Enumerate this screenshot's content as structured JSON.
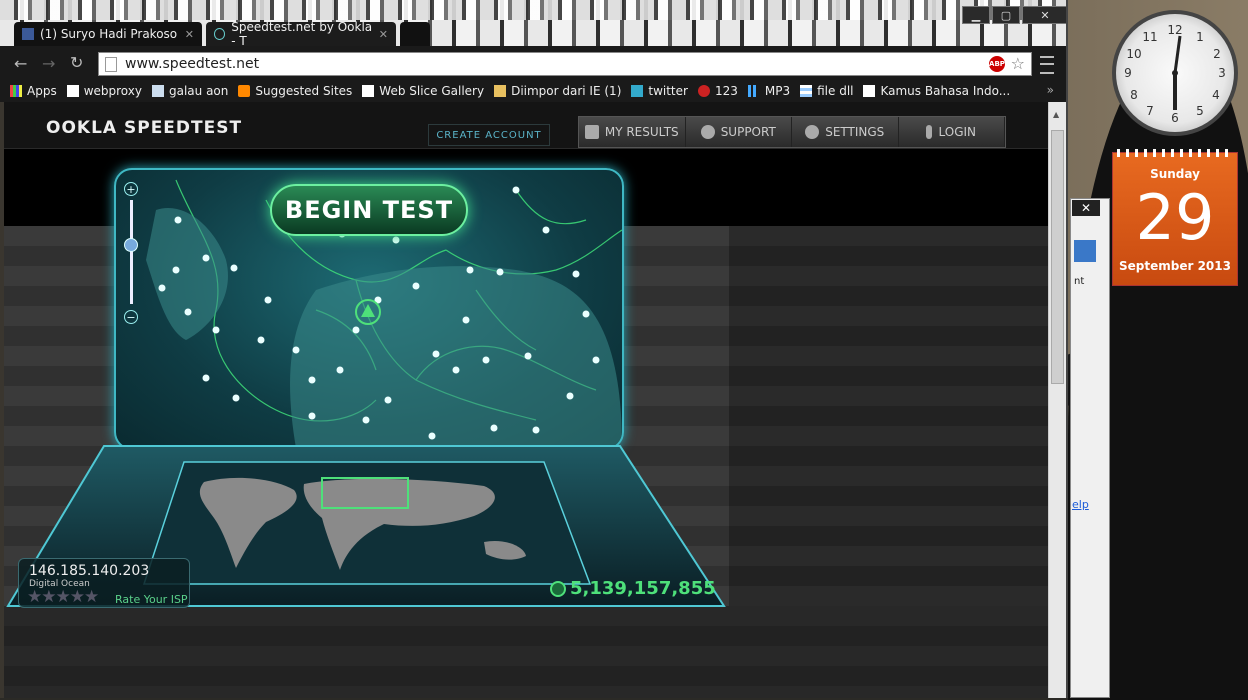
{
  "browser": {
    "tabs": [
      {
        "label": "(1) Suryo Hadi Prakoso",
        "favicon": "facebook-icon",
        "active": false
      },
      {
        "label": "Speedtest.net by Ookla - T",
        "favicon": "speedtest-icon",
        "active": true
      }
    ],
    "window_controls": {
      "minimize": "▁",
      "maximize": "▢",
      "close": "✕"
    },
    "address": "www.speedtest.net",
    "bookmarks": [
      {
        "label": "Apps",
        "icon": "apps-grid-icon"
      },
      {
        "label": "webproxy",
        "icon": "page-icon"
      },
      {
        "label": "galau aon",
        "icon": "folder-icon"
      },
      {
        "label": "Suggested Sites",
        "icon": "suggested-icon"
      },
      {
        "label": "Web Slice Gallery",
        "icon": "page-icon"
      },
      {
        "label": "Diimpor dari IE (1)",
        "icon": "folder-icon"
      },
      {
        "label": "twitter",
        "icon": "twitter-icon"
      },
      {
        "label": "123",
        "icon": "circle-icon"
      },
      {
        "label": "MP3",
        "icon": "bars-icon"
      },
      {
        "label": "file dll",
        "icon": "grid-icon"
      },
      {
        "label": "Kamus Bahasa Indo...",
        "icon": "page-icon"
      }
    ],
    "bookmarks_more": "»"
  },
  "speedtest": {
    "logo": "OOKLA  SPEEDTEST",
    "create_account": "CREATE ACCOUNT",
    "nav": [
      {
        "label": "MY RESULTS",
        "icon": "results-icon"
      },
      {
        "label": "SUPPORT",
        "icon": "help-icon"
      },
      {
        "label": "SETTINGS",
        "icon": "gear-icon"
      },
      {
        "label": "LOGIN",
        "icon": "user-icon"
      }
    ],
    "begin_test": "BEGIN TEST",
    "zoom_plus": "+",
    "zoom_minus": "−",
    "ip_address": "146.185.140.203",
    "isp": "Digital Ocean",
    "stars": "★★★★★",
    "rate_isp": "Rate Your ISP",
    "counter": "5,139,157,855"
  },
  "desktop": {
    "calendar": {
      "day": "Sunday",
      "date": "29",
      "month_year": "September 2013"
    },
    "clock": {
      "hour": 12,
      "minute": 30
    },
    "bg_window": {
      "close": "✕",
      "tab": "nt",
      "link": "elp"
    }
  },
  "colors": {
    "accent_green": "#4ee07a",
    "map_teal": "#1d6a73",
    "calendar_orange": "#e06a20"
  }
}
